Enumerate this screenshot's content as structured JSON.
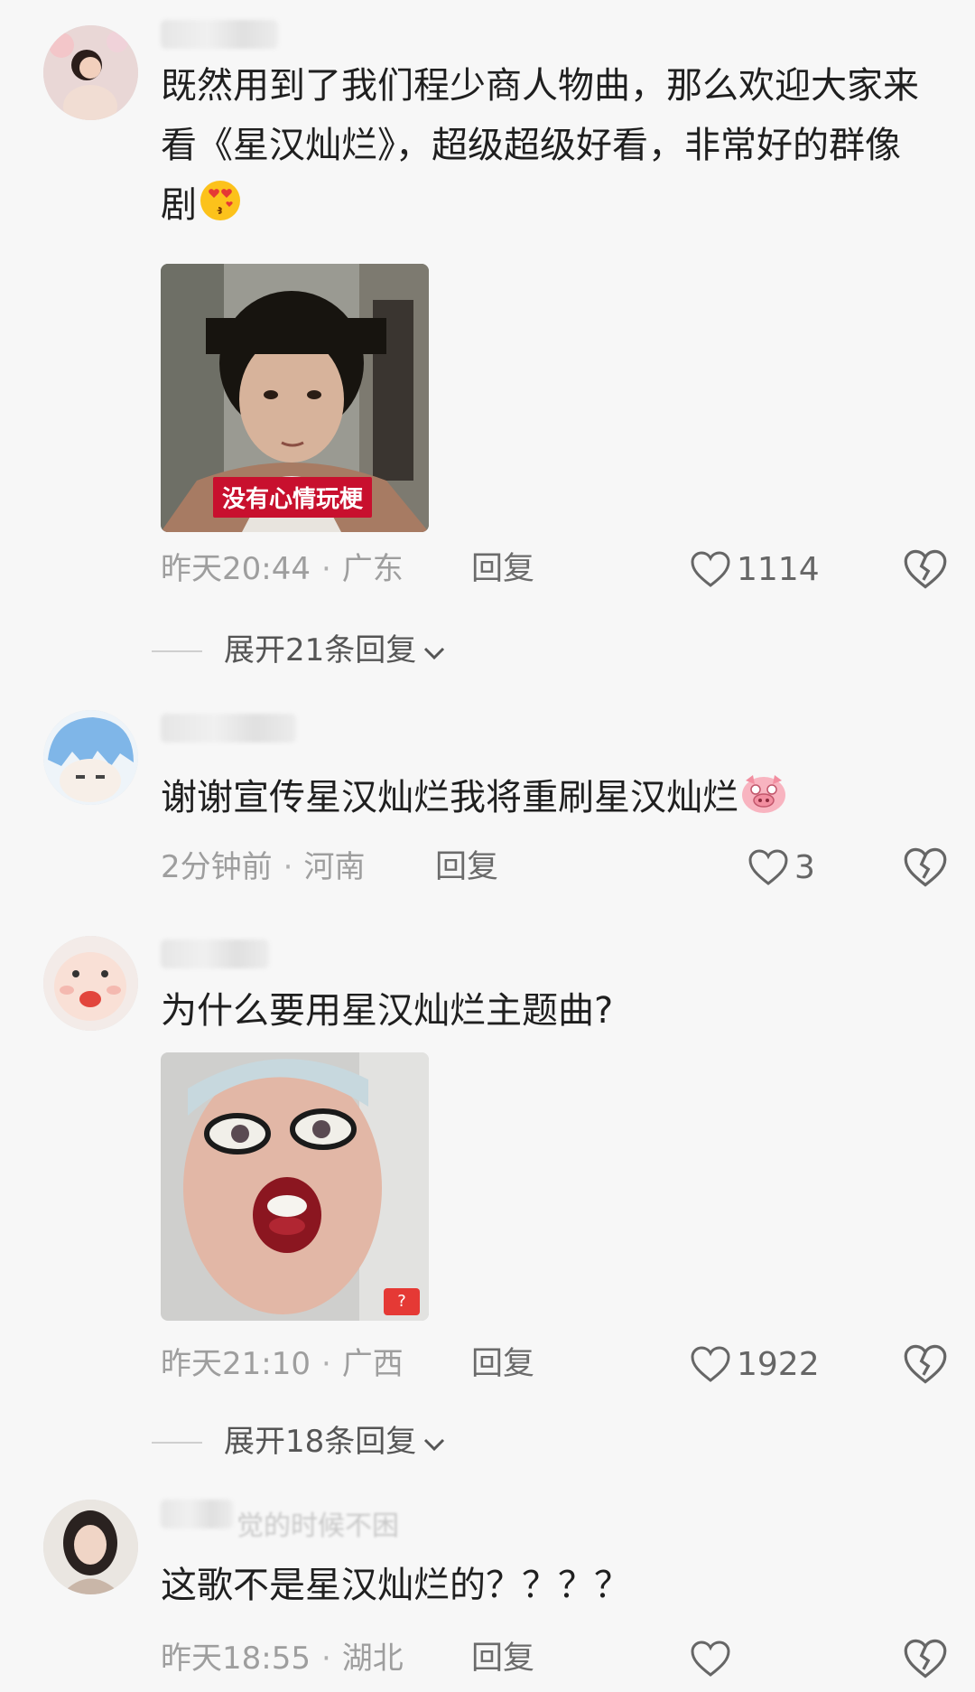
{
  "comments": [
    {
      "text": "既然用到了我们程少商人物曲，那么欢迎大家来看《星汉灿烂》，超级超级好看，非常好的群像剧",
      "emoji": "kissing-heart-emoji",
      "media_caption": "没有心情玩梗",
      "time": "昨天20:44",
      "location": "广东",
      "reply_label": "回复",
      "likes": "1114",
      "expand_label": "展开21条回复"
    },
    {
      "text": "谢谢宣传星汉灿烂我将重刷星汉灿烂",
      "emoji": "pig-face-emoji",
      "time": "2分钟前",
      "location": "河南",
      "reply_label": "回复",
      "likes": "3"
    },
    {
      "text": "为什么要用星汉灿烂主题曲?",
      "media_badge": "?",
      "time": "昨天21:10",
      "location": "广西",
      "reply_label": "回复",
      "likes": "1922",
      "expand_label": "展开18条回复"
    },
    {
      "username_partial": "觉的时候不困",
      "text": "这歌不是星汉灿烂的？？？？",
      "time": "昨天18:55",
      "location": "湖北",
      "reply_label": "回复"
    }
  ],
  "separator": "·",
  "colors": {
    "background": "#f7f7f7",
    "text": "#1f1f1f",
    "meta": "#9e9e9e",
    "caption_bg": "#c8102e"
  }
}
